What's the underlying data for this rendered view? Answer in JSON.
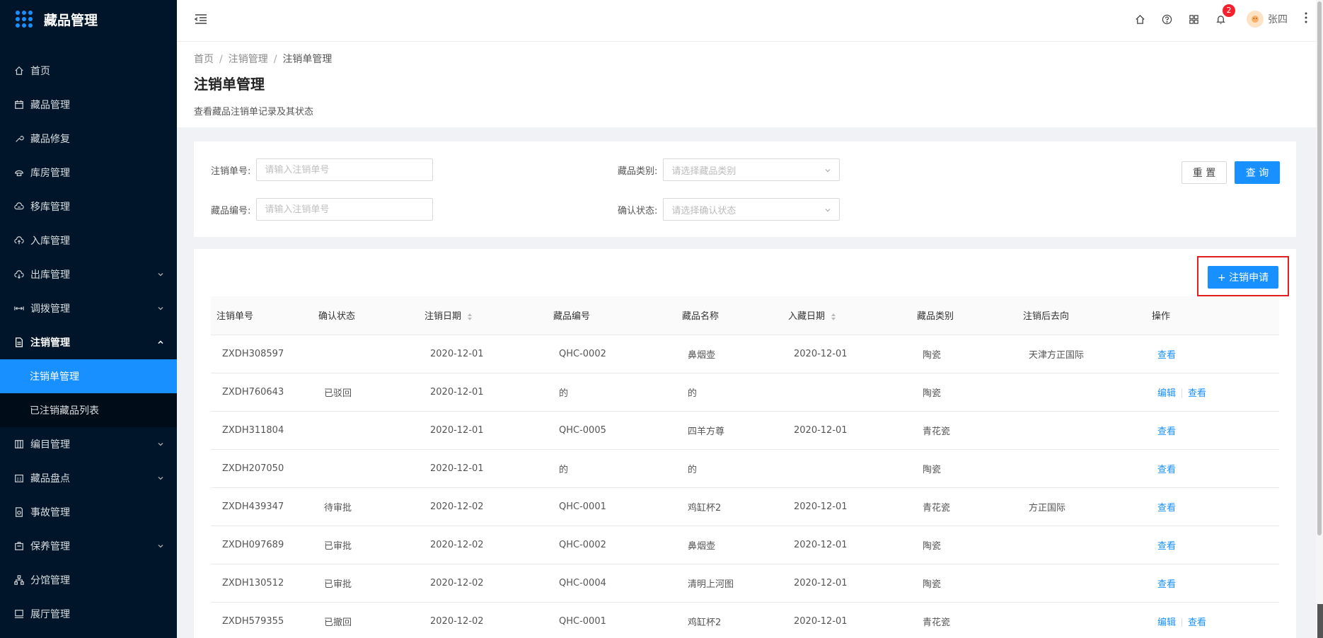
{
  "app": {
    "title": "藏品管理"
  },
  "sidebar": {
    "items": [
      {
        "label": "首页",
        "icon": "home-icon"
      },
      {
        "label": "藏品管理",
        "icon": "calendar-icon"
      },
      {
        "label": "藏品修复",
        "icon": "wrench-icon"
      },
      {
        "label": "库房管理",
        "icon": "warehouse-icon"
      },
      {
        "label": "移库管理",
        "icon": "cloud-transfer-icon"
      },
      {
        "label": "入库管理",
        "icon": "cloud-upload-icon"
      },
      {
        "label": "出库管理",
        "icon": "cloud-download-icon",
        "chevron": "down"
      },
      {
        "label": "调拨管理",
        "icon": "transfer-icon",
        "chevron": "down"
      },
      {
        "label": "注销管理",
        "icon": "file-icon",
        "chevron": "up"
      }
    ],
    "submenu": [
      {
        "label": "注销单管理",
        "active": true
      },
      {
        "label": "已注销藏品列表",
        "active": false
      }
    ],
    "items_after": [
      {
        "label": "编目管理",
        "icon": "catalog-icon",
        "chevron": "down"
      },
      {
        "label": "藏品盘点",
        "icon": "inventory-icon",
        "chevron": "down"
      },
      {
        "label": "事故管理",
        "icon": "accident-icon"
      },
      {
        "label": "保养管理",
        "icon": "maintenance-icon",
        "chevron": "down"
      },
      {
        "label": "分馆管理",
        "icon": "branch-icon"
      },
      {
        "label": "展厅管理",
        "icon": "monitor-icon"
      }
    ]
  },
  "header": {
    "notification_count": "2",
    "username": "张四"
  },
  "breadcrumb": {
    "items": [
      "首页",
      "注销管理",
      "注销单管理"
    ]
  },
  "page": {
    "title": "注销单管理",
    "description": "查看藏品注销单记录及其状态"
  },
  "search": {
    "cancel_no_label": "注销单号:",
    "cancel_no_placeholder": "请输入注销单号",
    "category_label": "藏品类别:",
    "category_placeholder": "请选择藏品类别",
    "item_no_label": "藏品编号:",
    "item_no_placeholder": "请输入注销单号",
    "status_label": "确认状态:",
    "status_placeholder": "请选择确认状态",
    "reset_label": "重 置",
    "query_label": "查 询"
  },
  "table": {
    "add_button": "+ 注销申请",
    "columns": [
      "注销单号",
      "确认状态",
      "注销日期",
      "藏品编号",
      "藏品名称",
      "入藏日期",
      "藏品类别",
      "注销后去向",
      "操作"
    ],
    "view_label": "查看",
    "edit_label": "编辑",
    "rows": [
      {
        "no": "ZXDH308597",
        "status": "",
        "date": "2020-12-01",
        "item_no": "QHC-0002",
        "name": "鼻烟壶",
        "in_date": "2020-12-01",
        "category": "陶瓷",
        "dest": "天津方正国际",
        "edit": false
      },
      {
        "no": "ZXDH760643",
        "status": "已驳回",
        "date": "2020-12-01",
        "item_no": "的",
        "name": "的",
        "in_date": "",
        "category": "陶瓷",
        "dest": "",
        "edit": true
      },
      {
        "no": "ZXDH311804",
        "status": "",
        "date": "2020-12-01",
        "item_no": "QHC-0005",
        "name": "四羊方尊",
        "in_date": "2020-12-01",
        "category": "青花瓷",
        "dest": "",
        "edit": false
      },
      {
        "no": "ZXDH207050",
        "status": "",
        "date": "2020-12-01",
        "item_no": "的",
        "name": "的",
        "in_date": "",
        "category": "陶瓷",
        "dest": "",
        "edit": false
      },
      {
        "no": "ZXDH439347",
        "status": "待审批",
        "date": "2020-12-02",
        "item_no": "QHC-0001",
        "name": "鸡缸杯2",
        "in_date": "2020-12-01",
        "category": "青花瓷",
        "dest": "方正国际",
        "edit": false
      },
      {
        "no": "ZXDH097689",
        "status": "已审批",
        "date": "2020-12-02",
        "item_no": "QHC-0002",
        "name": "鼻烟壶",
        "in_date": "2020-12-01",
        "category": "陶瓷",
        "dest": "",
        "edit": false
      },
      {
        "no": "ZXDH130512",
        "status": "已审批",
        "date": "2020-12-02",
        "item_no": "QHC-0004",
        "name": "清明上河图",
        "in_date": "2020-12-01",
        "category": "陶瓷",
        "dest": "",
        "edit": false
      },
      {
        "no": "ZXDH579355",
        "status": "已撤回",
        "date": "2020-12-02",
        "item_no": "QHC-0001",
        "name": "鸡缸杯2",
        "in_date": "2020-12-01",
        "category": "青花瓷",
        "dest": "",
        "edit": true
      }
    ]
  },
  "colors": {
    "sidebar_bg": "#001529",
    "primary": "#1890ff",
    "highlight_border": "#e02020",
    "badge": "#f5222d"
  }
}
